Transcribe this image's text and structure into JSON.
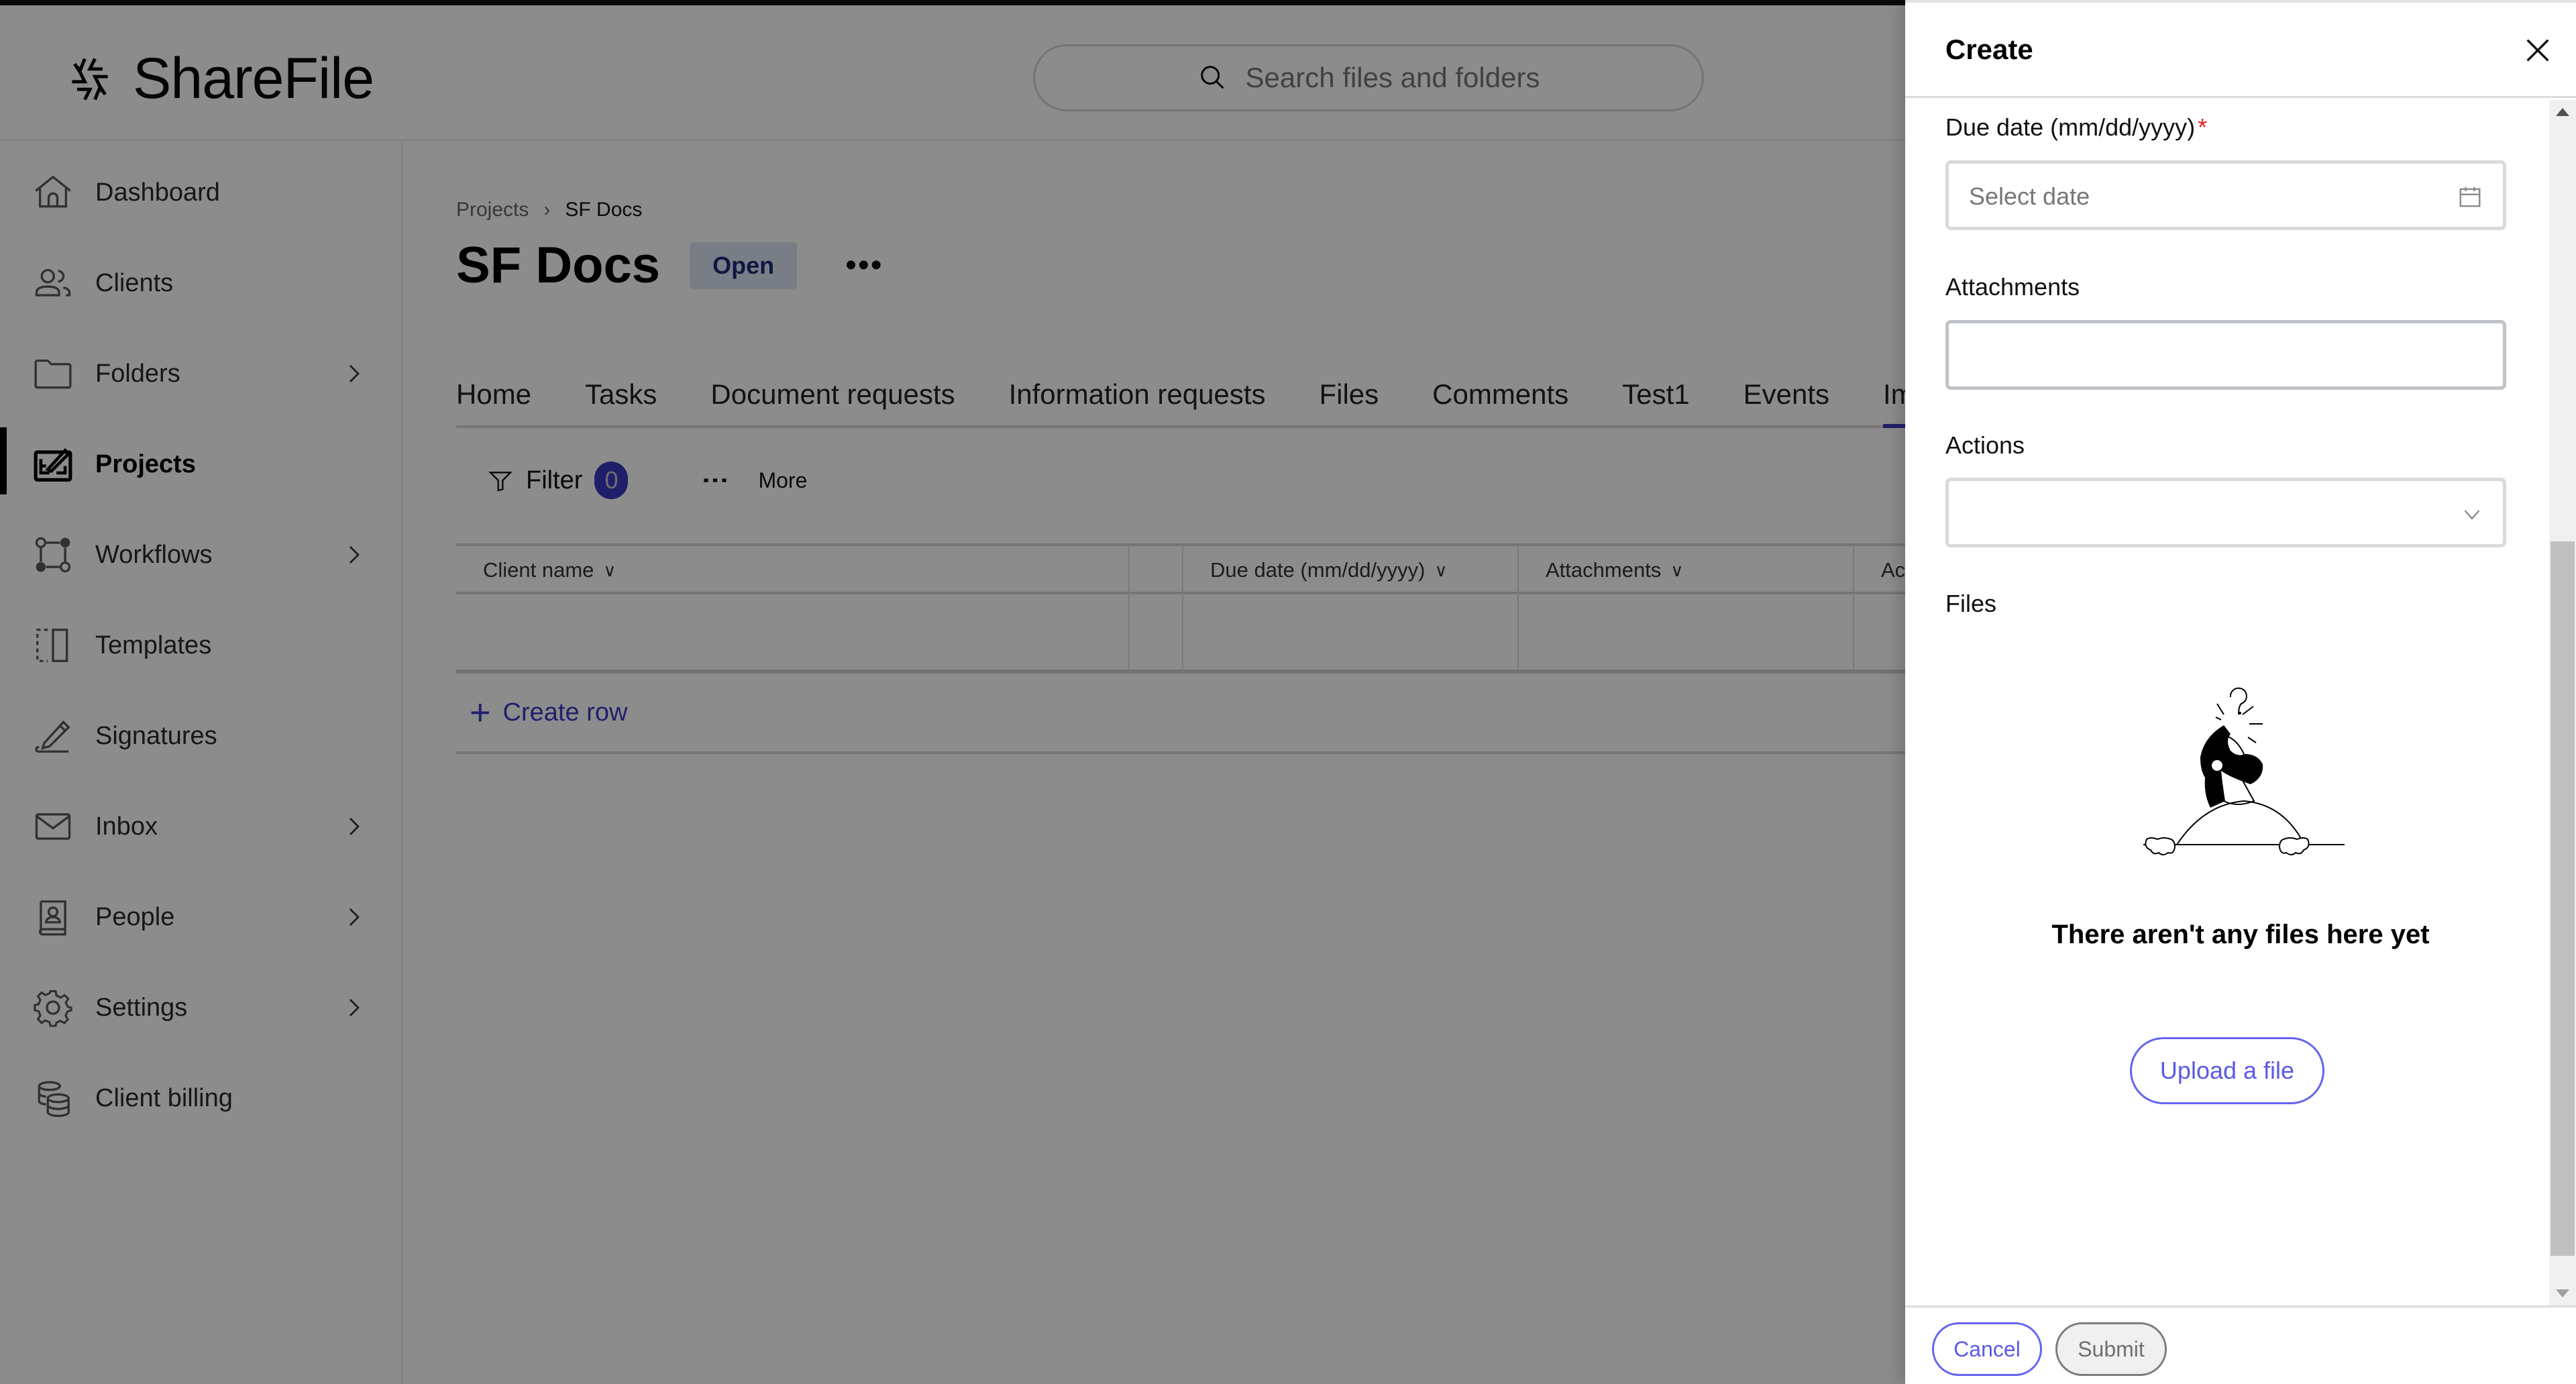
{
  "app": {
    "brand": "ShareFile",
    "search_placeholder": "Search files and folders"
  },
  "sidebar": {
    "items": [
      {
        "label": "Dashboard",
        "icon": "home-icon",
        "has_submenu": false,
        "active": false
      },
      {
        "label": "Clients",
        "icon": "clients-icon",
        "has_submenu": false,
        "active": false
      },
      {
        "label": "Folders",
        "icon": "folder-icon",
        "has_submenu": true,
        "active": false
      },
      {
        "label": "Projects",
        "icon": "projects-icon",
        "has_submenu": false,
        "active": true
      },
      {
        "label": "Workflows",
        "icon": "workflows-icon",
        "has_submenu": true,
        "active": false
      },
      {
        "label": "Templates",
        "icon": "templates-icon",
        "has_submenu": false,
        "active": false
      },
      {
        "label": "Signatures",
        "icon": "signature-pen-icon",
        "has_submenu": false,
        "active": false
      },
      {
        "label": "Inbox",
        "icon": "envelope-icon",
        "has_submenu": true,
        "active": false
      },
      {
        "label": "People",
        "icon": "contact-book-icon",
        "has_submenu": true,
        "active": false
      },
      {
        "label": "Settings",
        "icon": "gear-icon",
        "has_submenu": true,
        "active": false
      },
      {
        "label": "Client billing",
        "icon": "coins-icon",
        "has_submenu": false,
        "active": false
      }
    ]
  },
  "main": {
    "breadcrumb": [
      {
        "label": "Projects"
      },
      {
        "label": "SF Docs"
      }
    ],
    "title": "SF Docs",
    "status": "Open",
    "more_actions": "•••",
    "tabs": [
      {
        "label": "Home"
      },
      {
        "label": "Tasks"
      },
      {
        "label": "Document requests"
      },
      {
        "label": "Information requests"
      },
      {
        "label": "Files"
      },
      {
        "label": "Comments"
      },
      {
        "label": "Test1"
      },
      {
        "label": "Events"
      },
      {
        "label": "Imp",
        "active": true
      }
    ],
    "toolbar": {
      "filter_label": "Filter",
      "filter_count": "0",
      "more_label": "More"
    },
    "table": {
      "columns": [
        {
          "label": "Client name"
        },
        {
          "label": ""
        },
        {
          "label": "Due date (mm/dd/yyyy)"
        },
        {
          "label": "Attachments"
        },
        {
          "label": "Ac"
        }
      ],
      "rows": [
        [
          "",
          "",
          "",
          "",
          ""
        ]
      ],
      "create_row_label": "Create row"
    }
  },
  "panel": {
    "title": "Create",
    "fields": {
      "due_date": {
        "label": "Due date (mm/dd/yyyy)",
        "required": "*",
        "placeholder": "Select date",
        "value": ""
      },
      "attachments": {
        "label": "Attachments",
        "value": ""
      },
      "actions": {
        "label": "Actions",
        "selected": ""
      },
      "files": {
        "label": "Files"
      }
    },
    "empty_state": {
      "message": "There aren't any files here yet",
      "upload_label": "Upload a file"
    },
    "scroll": {
      "thumb_fraction": 0.62,
      "position_fraction": 0.36
    },
    "footer": {
      "cancel_label": "Cancel",
      "submit_label": "Submit"
    }
  },
  "colors": {
    "accent": "#3b3bc4",
    "link": "#5a5ae8",
    "status_badge_bg": "#dde6f4",
    "status_badge_text": "#1e2a78",
    "required": "#dd2222"
  }
}
